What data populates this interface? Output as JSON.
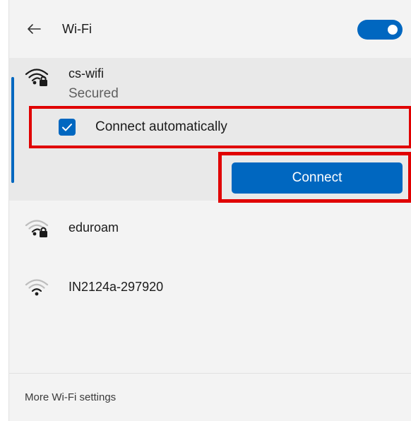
{
  "header": {
    "title": "Wi-Fi",
    "toggle_state": "on"
  },
  "networks": [
    {
      "name": "cs-wifi",
      "status": "Secured",
      "secured": true,
      "expanded": true,
      "connect_automatically_label": "Connect automatically",
      "connect_automatically_checked": true,
      "connect_label": "Connect"
    },
    {
      "name": "eduroam",
      "secured": true
    },
    {
      "name": "IN2124a-297920",
      "secured": false
    }
  ],
  "footer": {
    "settings_link": "More Wi-Fi settings"
  },
  "colors": {
    "accent": "#0067c0",
    "highlight": "#e00000",
    "panel_bg": "#f3f3f3",
    "selected_bg": "#e9e9e9"
  },
  "icons": [
    "back-arrow-icon",
    "wifi-secured-icon",
    "wifi-icon",
    "checkmark-icon"
  ]
}
